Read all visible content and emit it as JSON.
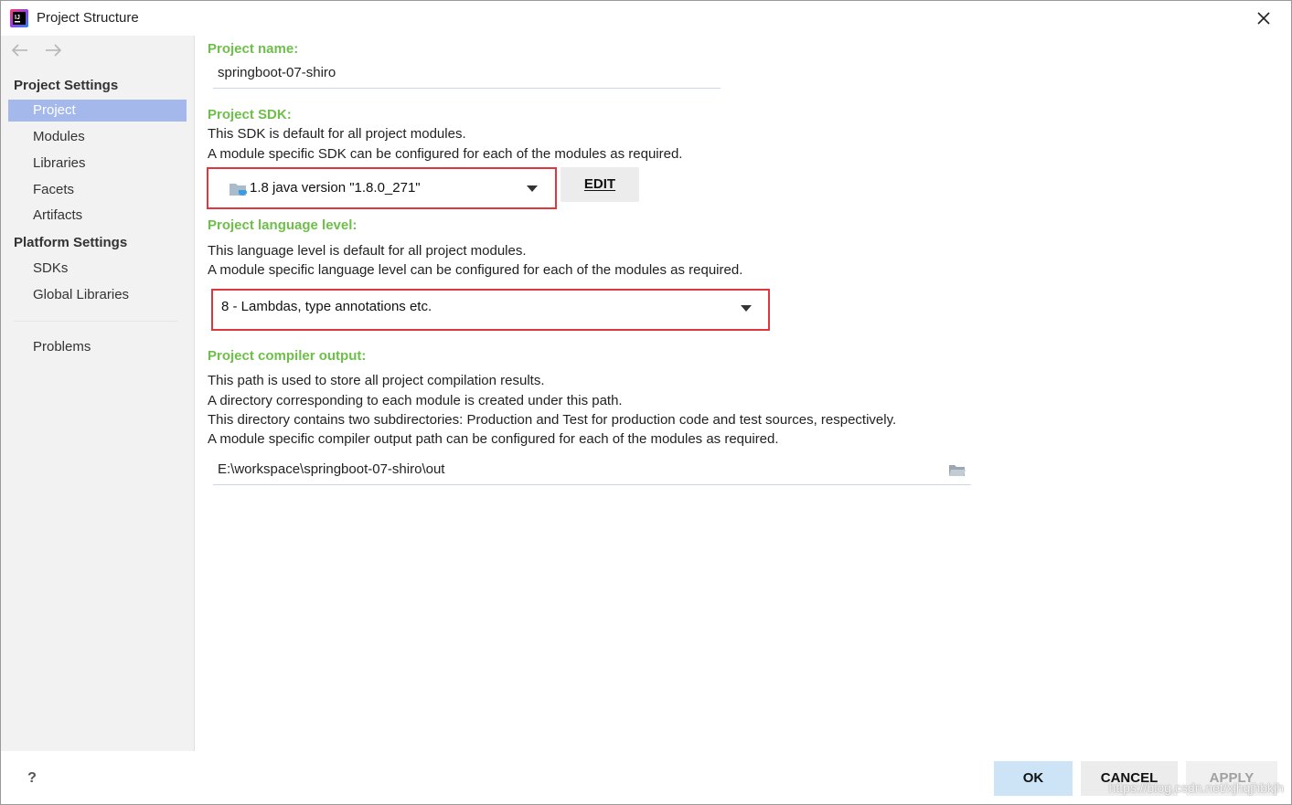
{
  "window": {
    "title": "Project Structure",
    "app_icon": "intellij-idea-icon"
  },
  "sidebar": {
    "sections": [
      {
        "header": "Project Settings",
        "items": [
          {
            "label": "Project",
            "selected": true
          },
          {
            "label": "Modules"
          },
          {
            "label": "Libraries"
          },
          {
            "label": "Facets"
          },
          {
            "label": "Artifacts"
          }
        ]
      },
      {
        "header": "Platform Settings",
        "items": [
          {
            "label": "SDKs"
          },
          {
            "label": "Global Libraries"
          }
        ]
      }
    ],
    "problems_label": "Problems",
    "help_label": "?"
  },
  "main": {
    "project_name": {
      "label": "Project name:",
      "value": "springboot-07-shiro"
    },
    "project_sdk": {
      "label": "Project SDK:",
      "desc_line1": "This SDK is default for all project modules.",
      "desc_line2": "A module specific SDK can be configured for each of the modules as required.",
      "selected": "1.8 java version \"1.8.0_271\"",
      "edit_label": "EDIT"
    },
    "language_level": {
      "label": "Project language level:",
      "desc_line1": "This language level is default for all project modules.",
      "desc_line2": "A module specific language level can be configured for each of the modules as required.",
      "selected": "8 - Lambdas, type annotations etc."
    },
    "compiler_output": {
      "label": "Project compiler output:",
      "desc_line1": "This path is used to store all project compilation results.",
      "desc_line2": "A directory corresponding to each module is created under this path.",
      "desc_line3": "This directory contains two subdirectories: Production and Test for production code and test sources, respectively.",
      "desc_line4": "A module specific compiler output path can be configured for each of the modules as required.",
      "path": "E:\\workspace\\springboot-07-shiro\\out"
    }
  },
  "buttons": {
    "ok": "OK",
    "cancel": "CANCEL",
    "apply": "APPLY"
  },
  "watermark": "https://blog.csdn.net/xjhqjhbkjh",
  "colors": {
    "section_label": "#6ebf4a",
    "selection": "#a4b8ec",
    "highlight_box": "#e0363d",
    "ok_button": "#cde4f7"
  }
}
